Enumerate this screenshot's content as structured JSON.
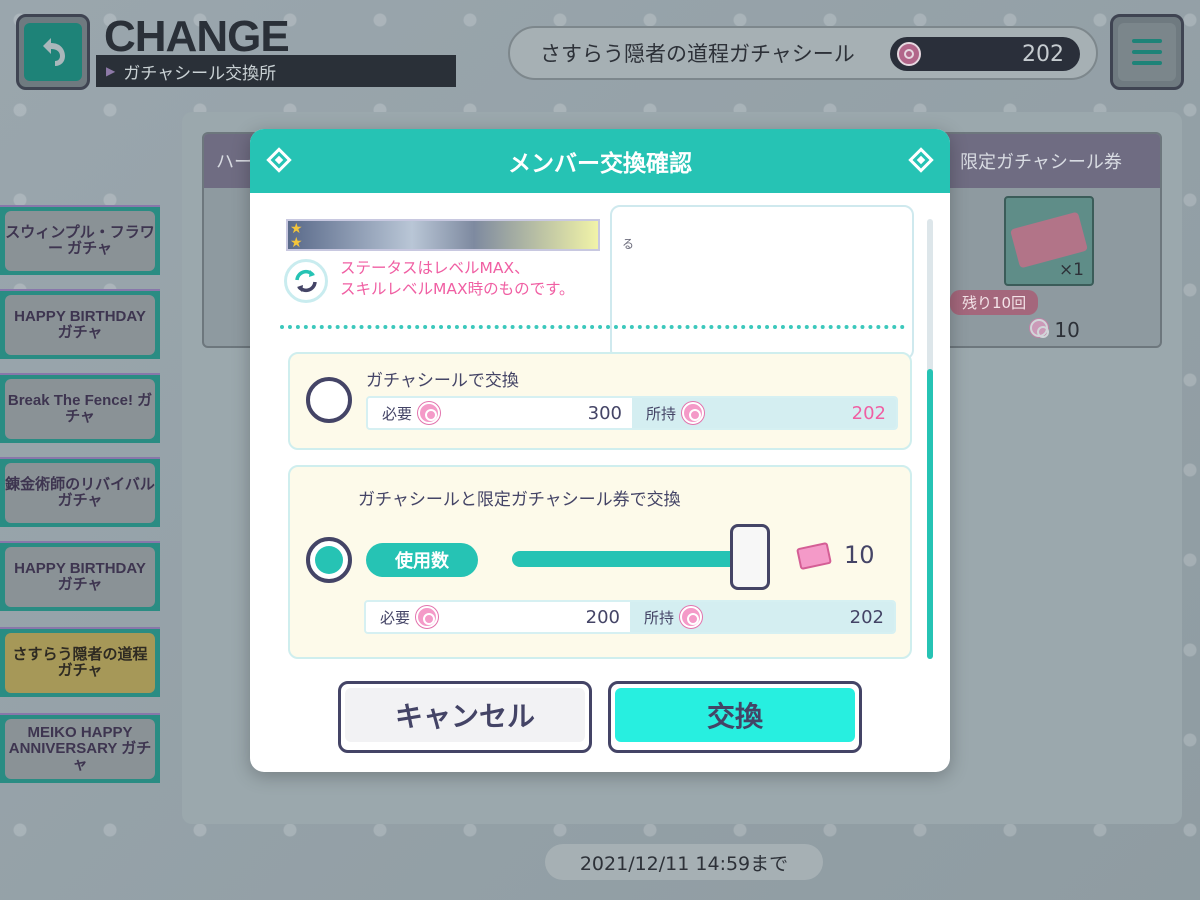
{
  "header": {
    "title": "CHANGE",
    "subtitle": "ガチャシール交換所",
    "seal_name": "さすらう隠者の道程ガチャシール",
    "seal_count": "202"
  },
  "banners": [
    {
      "label": "スウィンプル・フラワー ガチャ"
    },
    {
      "label": "HAPPY BIRTHDAY ガチャ"
    },
    {
      "label": "Break The Fence! ガチャ"
    },
    {
      "label": "錬金術師のリバイバル ガチャ"
    },
    {
      "label": "HAPPY BIRTHDAY ガチャ"
    },
    {
      "label": "さすらう隠者の道程 ガチャ"
    },
    {
      "label": "MEIKO HAPPY ANNIVERSARY ガチャ"
    }
  ],
  "background_cards": {
    "left_header": "ハー",
    "item_header": "限定ガチャシール券",
    "item_quantity": "×1",
    "remaining": "残り10回",
    "price": "10"
  },
  "footer": {
    "deadline": "2021/12/11 14:59まで"
  },
  "modal": {
    "title": "メンバー交換確認",
    "desc_partial": "る",
    "status_note_line1": "ステータスはレベルMAX、",
    "status_note_line2": "スキルレベルMAX時のものです。",
    "option1": {
      "title": "ガチャシールで交換",
      "need_label": "必要",
      "need_value": "300",
      "have_label": "所持",
      "have_value": "202",
      "selected": false
    },
    "option2": {
      "title": "ガチャシールと限定ガチャシール券で交換",
      "use_label": "使用数",
      "use_count": "10",
      "slider_fraction": 1.0,
      "need_label": "必要",
      "need_value": "200",
      "have_label": "所持",
      "have_value": "202",
      "selected": true
    },
    "cancel_label": "キャンセル",
    "confirm_label": "交換"
  },
  "colors": {
    "accent": "#26c3b4",
    "pink": "#f05fa3",
    "dark": "#444466"
  }
}
